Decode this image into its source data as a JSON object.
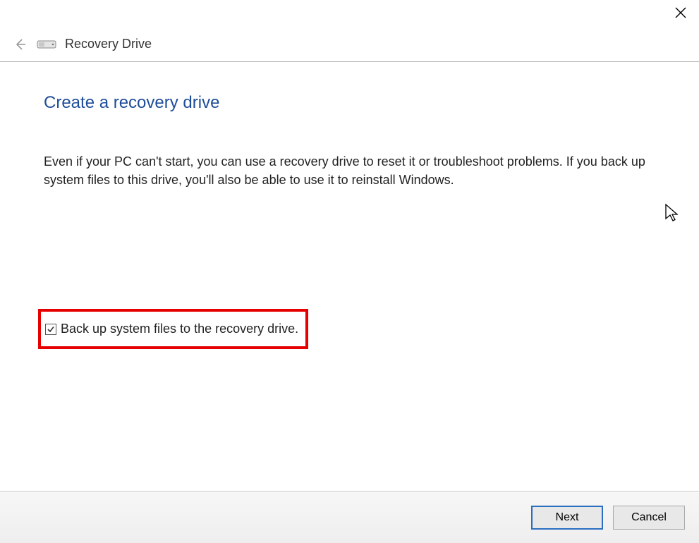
{
  "header": {
    "title": "Recovery Drive"
  },
  "main": {
    "heading": "Create a recovery drive",
    "description": "Even if your PC can't start, you can use a recovery drive to reset it or troubleshoot problems. If you back up system files to this drive, you'll also be able to use it to reinstall Windows.",
    "checkbox_label": "Back up system files to the recovery drive.",
    "checkbox_checked": true
  },
  "footer": {
    "next_label": "Next",
    "cancel_label": "Cancel"
  }
}
